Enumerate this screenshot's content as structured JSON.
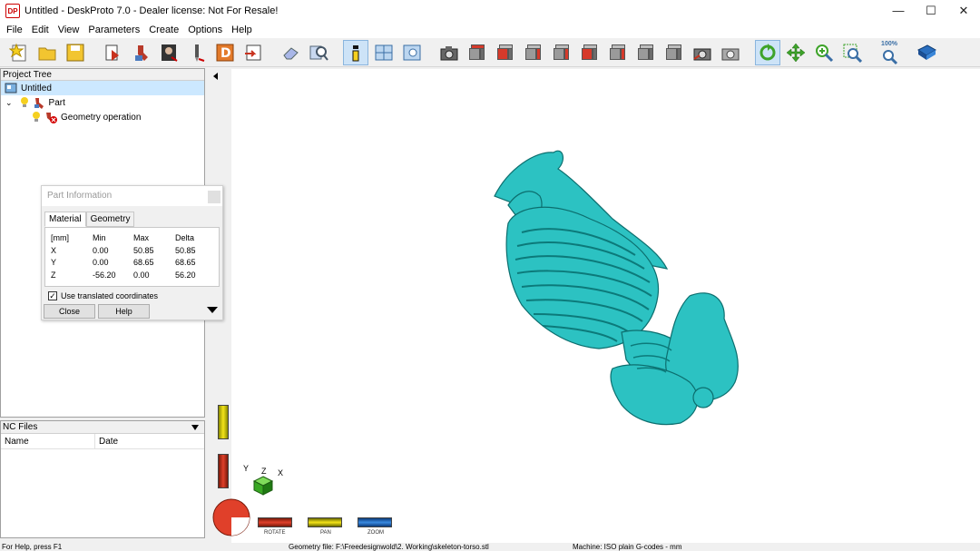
{
  "window": {
    "app_icon_text": "DP",
    "title": "Untitled - DeskProto 7.0 - Dealer license: Not For Resale!",
    "minimize": "—",
    "maximize": "☐",
    "close": "✕"
  },
  "menu": [
    "File",
    "Edit",
    "View",
    "Parameters",
    "Create",
    "Options",
    "Help"
  ],
  "toolbar": {
    "zoom_percent": "100%"
  },
  "project_tree": {
    "header": "Project Tree",
    "items": [
      {
        "label": "Untitled"
      },
      {
        "label": "Part"
      },
      {
        "label": "Geometry operation"
      }
    ]
  },
  "nc_files": {
    "header": "NC Files",
    "columns": [
      "Name",
      "Date"
    ]
  },
  "part_info": {
    "title": "Part Information",
    "tabs": [
      "Material",
      "Geometry"
    ],
    "headers": [
      "[mm]",
      "Min",
      "Max",
      "Delta"
    ],
    "rows": [
      [
        "X",
        "0.00",
        "50.85",
        "50.85"
      ],
      [
        "Y",
        "0.00",
        "68.65",
        "68.65"
      ],
      [
        "Z",
        "-56.20",
        "0.00",
        "56.20"
      ]
    ],
    "checkbox_label": "Use translated coordinates",
    "close_label": "Close",
    "help_label": "Help"
  },
  "viewport": {
    "axis_labels": {
      "y": "Y",
      "z": "Z",
      "x": "X"
    },
    "gauges": {
      "rotate": "ROTATE",
      "pan": "PAN",
      "zoom": "ZOOM"
    },
    "model_color": "#2cc2c2"
  },
  "status": {
    "help": "For Help, press F1",
    "geometry_file": "Geometry file: F:\\Freedesignwold\\2. Working\\skeleton-torso.stl",
    "machine": "Machine: ISO plain G-codes - mm"
  }
}
